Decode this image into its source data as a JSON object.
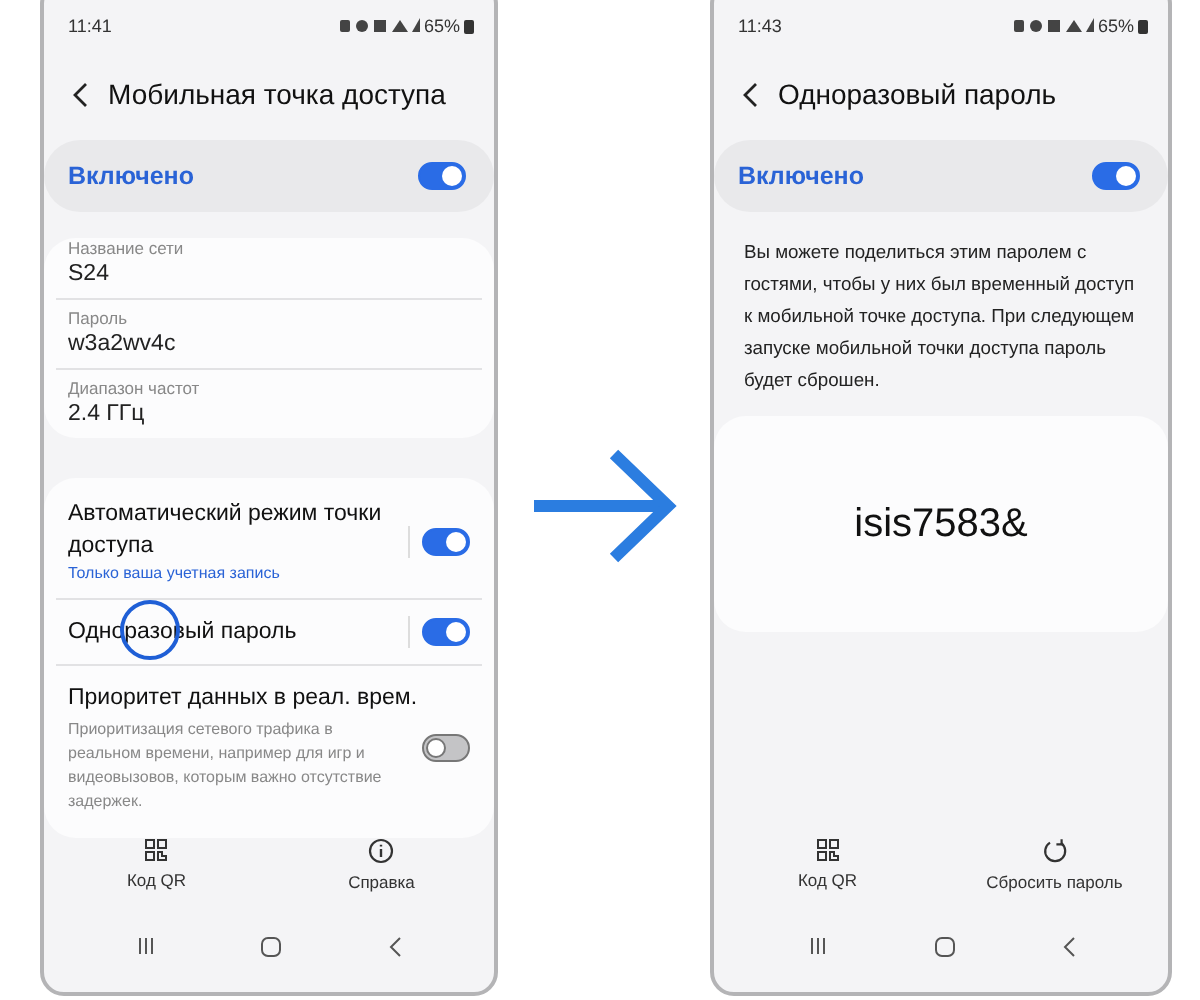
{
  "screens": [
    {
      "status_bar": {
        "time": "11:41",
        "battery": "65%"
      },
      "title": "Мобильная точка доступа",
      "master": {
        "label": "Включено",
        "on": true
      },
      "info_rows": [
        {
          "label": "Название сети",
          "value": "S24"
        },
        {
          "label": "Пароль",
          "value": "w3a2wv4c"
        },
        {
          "label": "Диапазон частот",
          "value": "2.4 ГГц"
        }
      ],
      "settings": [
        {
          "title": "Автоматический режим точки доступа",
          "subtitle": "Только ваша учетная запись",
          "on": true,
          "divider": true
        },
        {
          "title": "Одноразовый пароль",
          "on": true,
          "divider": true,
          "tapped": true
        },
        {
          "title": "Приоритет данных в реал. врем.",
          "description": "Приоритизация сетевого трафика в реальном времени, например для игр и видеовызовов, которым важно отсутствие задержек.",
          "on": false,
          "divider": false
        }
      ],
      "bottom_actions": [
        {
          "label": "Код QR",
          "kind": "qr"
        },
        {
          "label": "Справка",
          "kind": "info"
        }
      ]
    },
    {
      "status_bar": {
        "time": "11:43",
        "battery": "65%"
      },
      "title": "Одноразовый пароль",
      "master": {
        "label": "Включено",
        "on": true
      },
      "description": "Вы можете поделиться этим паролем с гостями, чтобы у них был временный доступ к мобильной точке доступа. При следующем запуске мобильной точки доступа пароль будет сброшен.",
      "password": "isis7583&",
      "bottom_actions": [
        {
          "label": "Код QR",
          "kind": "qr"
        },
        {
          "label": "Сбросить пароль",
          "kind": "reset"
        }
      ]
    }
  ]
}
